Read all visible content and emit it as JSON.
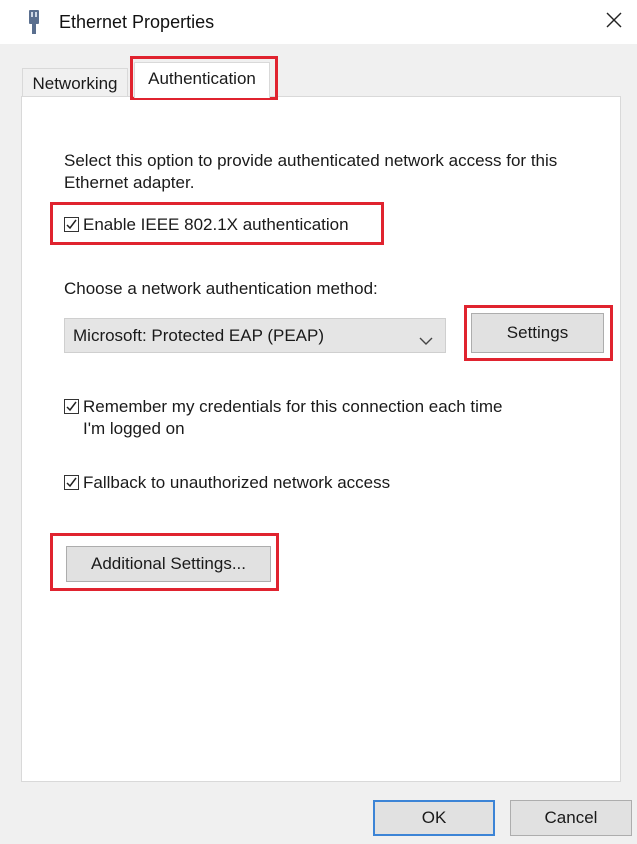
{
  "window": {
    "title": "Ethernet Properties",
    "icon": "network-adapter-icon",
    "close_icon": "close-icon"
  },
  "tabs": [
    {
      "label": "Networking",
      "selected": false
    },
    {
      "label": "Authentication",
      "selected": true
    }
  ],
  "auth": {
    "description": "Select this option to provide authenticated network access for this Ethernet adapter.",
    "enable_8021x": {
      "label": "Enable IEEE 802.1X authentication",
      "checked": true
    },
    "method_label": "Choose a network authentication method:",
    "method_select": {
      "value": "Microsoft: Protected EAP (PEAP)"
    },
    "settings_button": "Settings",
    "remember_credentials": {
      "label": "Remember my credentials for this connection each time I'm logged on",
      "checked": true
    },
    "fallback": {
      "label": "Fallback to unauthorized network access",
      "checked": true
    },
    "additional_settings_button": "Additional Settings..."
  },
  "footer": {
    "ok": "OK",
    "cancel": "Cancel"
  },
  "colors": {
    "highlight": "#e0232f",
    "default_button_border": "#3c84d6"
  }
}
